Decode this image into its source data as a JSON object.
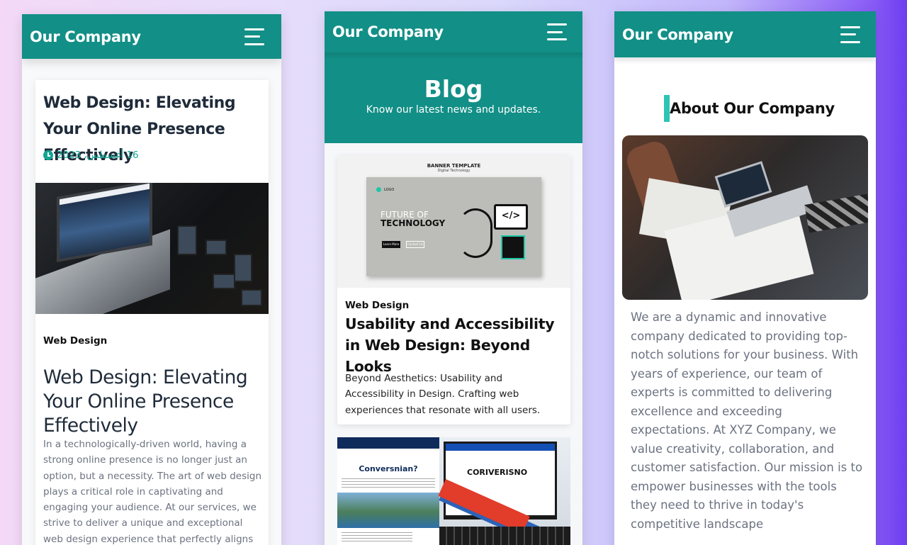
{
  "brand": "Our Company",
  "colors": {
    "primary": "#128f86",
    "accent": "#2ec4b6",
    "date": "#12a593"
  },
  "phone1": {
    "header_title": "Web Design: Elevating Your Online Presence Effectively",
    "date": "16 أغسطس، 2023",
    "category": "Web Design",
    "title": "Web Design: Elevating Your Online Presence Effectively",
    "body": "In a technologically-driven world, having a strong online presence is no longer just an option, but a necessity. The art of web design plays a critical role in captivating and engaging your audience. At our services, we strive to deliver a unique and exceptional web design experience that perfectly aligns with"
  },
  "phone2": {
    "hero_title": "Blog",
    "hero_subtitle": "Know our latest news and updates.",
    "card1": {
      "banner_title": "BANNER TEMPLATE",
      "banner_subtitle": "Digital Technology",
      "banner_logo": "LOGO",
      "banner_heading1": "FUTURE OF",
      "banner_heading2": "TECHNOLOGY",
      "banner_btn1": "Learn More",
      "banner_btn2": "Contact Us",
      "banner_code": "</>",
      "category": "Web Design",
      "title": "Usability and Accessibility in Web Design: Beyond Looks",
      "excerpt": "Beyond Aesthetics: Usability and Accessibility in Design. Crafting web experiences that resonate with all users."
    },
    "card2": {
      "left_title": "Conversnian?",
      "right_title": "CORIVERISNO"
    }
  },
  "phone3": {
    "heading": "About Our Company",
    "body": "We are a dynamic and innovative company dedicated to providing top-notch solutions for your business. With years of experience, our team of experts is committed to delivering excellence and exceeding expectations. At XYZ Company, we value creativity, collaboration, and customer satisfaction. Our mission is to empower businesses with the tools they need to thrive in today's competitive landscape"
  }
}
